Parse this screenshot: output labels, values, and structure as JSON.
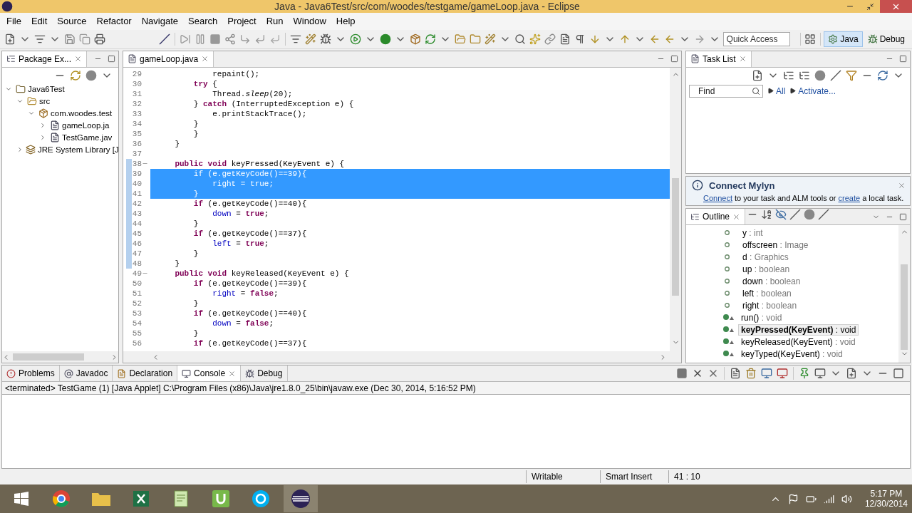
{
  "window": {
    "title": "Java - Java6Test/src/com/woodes/testgame/gameLoop.java - Eclipse"
  },
  "menu": [
    "File",
    "Edit",
    "Source",
    "Refactor",
    "Navigate",
    "Search",
    "Project",
    "Run",
    "Window",
    "Help"
  ],
  "toolbar": {
    "quick_access": {
      "placeholder": "Quick Access"
    },
    "perspectives": [
      {
        "label": "Java",
        "selected": true
      },
      {
        "label": "Debug",
        "selected": false
      }
    ]
  },
  "package_explorer": {
    "tab": "Package Ex...",
    "tree": [
      {
        "label": "Java6Test",
        "kind": "project",
        "expanded": true,
        "children": [
          {
            "label": "src",
            "kind": "folder",
            "expanded": true,
            "children": [
              {
                "label": "com.woodes.test",
                "kind": "package",
                "expanded": true,
                "children": [
                  {
                    "label": "gameLoop.ja",
                    "kind": "file",
                    "expanded": false
                  },
                  {
                    "label": "TestGame.jav",
                    "kind": "file",
                    "expanded": false
                  }
                ]
              }
            ]
          },
          {
            "label": "JRE System Library [J",
            "kind": "library",
            "expanded": false
          }
        ]
      }
    ]
  },
  "editor": {
    "tab": "gameLoop.java",
    "lines": [
      {
        "number": "29",
        "segments": [
          {
            "t": "            repaint();",
            "kind": "plain"
          }
        ]
      },
      {
        "number": "30",
        "segments": [
          {
            "t": "        try",
            "kind": "keyword"
          },
          {
            "t": " {",
            "kind": "plain"
          }
        ]
      },
      {
        "number": "31",
        "segments": [
          {
            "t": "            Thread.",
            "kind": "plain"
          },
          {
            "t": "sleep",
            "kind": "static"
          },
          {
            "t": "(20);",
            "kind": "plain"
          }
        ]
      },
      {
        "number": "32",
        "segments": [
          {
            "t": "        } ",
            "kind": "plain"
          },
          {
            "t": "catch",
            "kind": "keyword"
          },
          {
            "t": " (InterruptedException e) {",
            "kind": "plain"
          }
        ]
      },
      {
        "number": "33",
        "segments": [
          {
            "t": "            e.printStackTrace();",
            "kind": "plain"
          }
        ]
      },
      {
        "number": "34",
        "segments": [
          {
            "t": "        }",
            "kind": "plain"
          }
        ]
      },
      {
        "number": "35",
        "segments": [
          {
            "t": "        }",
            "kind": "plain"
          }
        ]
      },
      {
        "number": "36",
        "segments": [
          {
            "t": "    }",
            "kind": "plain"
          }
        ]
      },
      {
        "number": "37"
      },
      {
        "number": "38",
        "fold": true,
        "marked": true,
        "segments": [
          {
            "t": "    public void",
            "kind": "keyword"
          },
          {
            "t": " keyPressed(KeyEvent e) {",
            "kind": "plain"
          }
        ]
      },
      {
        "number": "39",
        "marked": true,
        "selected": true,
        "segments": [
          {
            "t": "        if",
            "kind": "keyword"
          },
          {
            "t": " (e.getKeyCode()==39){",
            "kind": "plain"
          }
        ]
      },
      {
        "number": "40",
        "marked": true,
        "selected": true,
        "segments": [
          {
            "t": "            right",
            "kind": "field"
          },
          {
            "t": " = ",
            "kind": "plain"
          },
          {
            "t": "true",
            "kind": "keyword"
          },
          {
            "t": ";",
            "kind": "plain"
          }
        ]
      },
      {
        "number": "41",
        "marked": true,
        "selected": true,
        "segments": [
          {
            "t": "        }",
            "kind": "plain"
          }
        ]
      },
      {
        "number": "42",
        "marked": true,
        "segments": [
          {
            "t": "        if",
            "kind": "keyword"
          },
          {
            "t": " (e.getKeyCode()==40){",
            "kind": "plain"
          }
        ]
      },
      {
        "number": "43",
        "marked": true,
        "segments": [
          {
            "t": "            down",
            "kind": "field"
          },
          {
            "t": " = ",
            "kind": "plain"
          },
          {
            "t": "true",
            "kind": "keyword"
          },
          {
            "t": ";",
            "kind": "plain"
          }
        ]
      },
      {
        "number": "44",
        "marked": true,
        "segments": [
          {
            "t": "        }",
            "kind": "plain"
          }
        ]
      },
      {
        "number": "45",
        "marked": true,
        "segments": [
          {
            "t": "        if",
            "kind": "keyword"
          },
          {
            "t": " (e.getKeyCode()==37){",
            "kind": "plain"
          }
        ]
      },
      {
        "number": "46",
        "marked": true,
        "segments": [
          {
            "t": "            left",
            "kind": "field"
          },
          {
            "t": " = ",
            "kind": "plain"
          },
          {
            "t": "true",
            "kind": "keyword"
          },
          {
            "t": ";",
            "kind": "plain"
          }
        ]
      },
      {
        "number": "47",
        "marked": true,
        "segments": [
          {
            "t": "        }",
            "kind": "plain"
          }
        ]
      },
      {
        "number": "48",
        "marked": true,
        "segments": [
          {
            "t": "    }",
            "kind": "plain"
          }
        ]
      },
      {
        "number": "49",
        "fold": true,
        "segments": [
          {
            "t": "    public void",
            "kind": "keyword"
          },
          {
            "t": " keyReleased(KeyEvent e) {",
            "kind": "plain"
          }
        ]
      },
      {
        "number": "50",
        "segments": [
          {
            "t": "        if",
            "kind": "keyword"
          },
          {
            "t": " (e.getKeyCode()==39){",
            "kind": "plain"
          }
        ]
      },
      {
        "number": "51",
        "segments": [
          {
            "t": "            right",
            "kind": "field"
          },
          {
            "t": " = ",
            "kind": "plain"
          },
          {
            "t": "false",
            "kind": "keyword"
          },
          {
            "t": ";",
            "kind": "plain"
          }
        ]
      },
      {
        "number": "52",
        "segments": [
          {
            "t": "        }",
            "kind": "plain"
          }
        ]
      },
      {
        "number": "53",
        "segments": [
          {
            "t": "        if",
            "kind": "keyword"
          },
          {
            "t": " (e.getKeyCode()==40){",
            "kind": "plain"
          }
        ]
      },
      {
        "number": "54",
        "segments": [
          {
            "t": "            down",
            "kind": "field"
          },
          {
            "t": " = ",
            "kind": "plain"
          },
          {
            "t": "false",
            "kind": "keyword"
          },
          {
            "t": ";",
            "kind": "plain"
          }
        ]
      },
      {
        "number": "55",
        "segments": [
          {
            "t": "        }",
            "kind": "plain"
          }
        ]
      },
      {
        "number": "56",
        "segments": [
          {
            "t": "        if",
            "kind": "keyword"
          },
          {
            "t": " (e.getKeyCode()==37){",
            "kind": "plain"
          }
        ]
      }
    ]
  },
  "task_list": {
    "tab": "Task List",
    "find": {
      "placeholder": "Find"
    },
    "filters": [
      "All",
      "Activate..."
    ]
  },
  "mylyn": {
    "title": "Connect Mylyn",
    "message": [
      {
        "t": "Connect",
        "link": true
      },
      {
        "t": " to your task and ALM tools or ",
        "link": false
      },
      {
        "t": "create",
        "link": true
      },
      {
        "t": " a local task.",
        "link": false
      }
    ]
  },
  "outline": {
    "tab": "Outline",
    "items": [
      {
        "name": "y",
        "type": ": int",
        "kind": "field",
        "selected": false
      },
      {
        "name": "offscreen",
        "type": ": Image",
        "kind": "field",
        "selected": false
      },
      {
        "name": "d",
        "type": ": Graphics",
        "kind": "field",
        "selected": false
      },
      {
        "name": "up",
        "type": ": boolean",
        "kind": "field",
        "selected": false
      },
      {
        "name": "down",
        "type": ": boolean",
        "kind": "field",
        "selected": false
      },
      {
        "name": "left",
        "type": ": boolean",
        "kind": "field",
        "selected": false
      },
      {
        "name": "right",
        "type": ": boolean",
        "kind": "field",
        "selected": false
      },
      {
        "name": "run()",
        "type": ": void",
        "kind": "method",
        "selected": false
      },
      {
        "name": "keyPressed(KeyEvent)",
        "type": ": void",
        "kind": "method",
        "selected": true
      },
      {
        "name": "keyReleased(KeyEvent)",
        "type": ": void",
        "kind": "method",
        "selected": false
      },
      {
        "name": "keyTyped(KeyEvent)",
        "type": ": void",
        "kind": "method",
        "selected": false
      }
    ]
  },
  "bottom_tabs": [
    {
      "label": "Problems",
      "kind": "problems",
      "selected": false
    },
    {
      "label": "Javadoc",
      "kind": "javadoc",
      "selected": false
    },
    {
      "label": "Declaration",
      "kind": "declaration",
      "selected": false
    },
    {
      "label": "Console",
      "kind": "console",
      "selected": true
    },
    {
      "label": "Debug",
      "kind": "debug",
      "selected": false
    }
  ],
  "console": {
    "header": "<terminated> TestGame (1) [Java Applet] C:\\Program Files (x86)\\Java\\jre1.8.0_25\\bin\\javaw.exe (Dec 30, 2014, 5:16:52 PM)"
  },
  "status_bar": [
    "Writable",
    "Smart Insert",
    "41 : 10"
  ],
  "taskbar": {
    "time": "5:17 PM",
    "date": "12/30/2014"
  }
}
